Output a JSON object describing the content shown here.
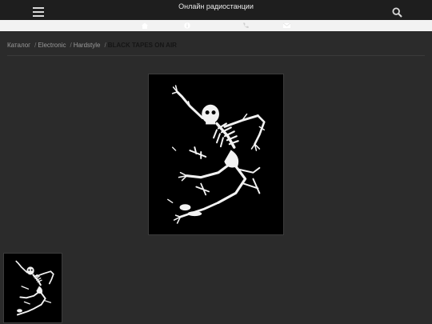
{
  "header": {
    "title": "Онлайн радиостанции",
    "menu_icon": "hamburger-menu-icon",
    "search_icon": "search-icon"
  },
  "icon_bar": {
    "icons": [
      "home-icon",
      "info-icon",
      "phone-icon",
      "mail-icon"
    ]
  },
  "breadcrumb": {
    "items": [
      "Каталог",
      "Electronic",
      "Hardstyle"
    ],
    "separator": "/",
    "current": "BLACK TAPES ON AIR"
  },
  "product": {
    "image": "skeleton-artwork",
    "thumbnail": "skeleton-artwork-thumbnail"
  },
  "colors": {
    "background": "#2b2b2b",
    "topbar": "#1e1e1e",
    "iconbar": "#f2f2f2"
  }
}
